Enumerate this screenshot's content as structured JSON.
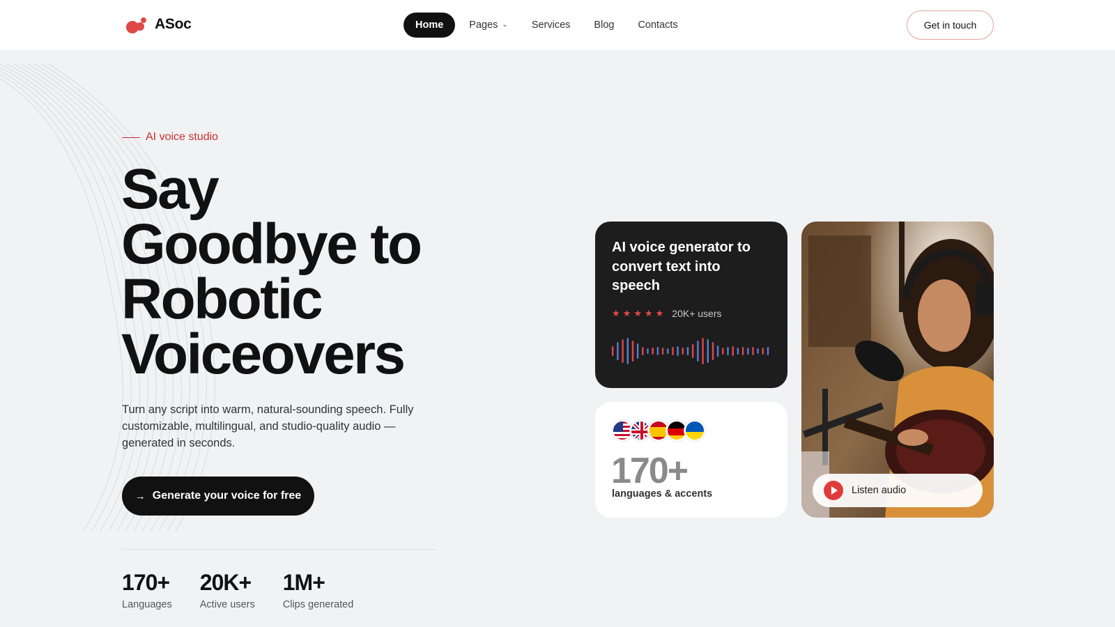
{
  "brand": {
    "name": "ASoc",
    "accent": "#e04848"
  },
  "nav": {
    "items": [
      {
        "label": "Home",
        "active": true
      },
      {
        "label": "Pages",
        "dropdown": true
      },
      {
        "label": "Services"
      },
      {
        "label": "Blog"
      },
      {
        "label": "Contacts"
      }
    ],
    "cta": "Get in touch"
  },
  "hero": {
    "eyebrow": "AI voice studio",
    "title": "Say Goodbye to Robotic Voiceovers",
    "description": "Turn any script into warm, natural-sounding speech. Fully customizable, multilingual, and studio-quality audio — generated in seconds.",
    "button": "Generate your voice for free",
    "stats": [
      {
        "value": "170+",
        "label": "Languages"
      },
      {
        "value": "20K+",
        "label": "Active users"
      },
      {
        "value": "1M+",
        "label": "Clips generated"
      }
    ]
  },
  "cards": {
    "generator": {
      "title": "AI voice generator to convert text into speech",
      "rating": 5,
      "users": "20K+ users"
    },
    "languages": {
      "flags": [
        "us-flag-icon",
        "uk-flag-icon",
        "spain-flag-icon",
        "germany-flag-icon",
        "ukraine-flag-icon"
      ],
      "count": "170+",
      "label": "languages & accents"
    },
    "photo": {
      "listen_label": "Listen audio"
    }
  }
}
